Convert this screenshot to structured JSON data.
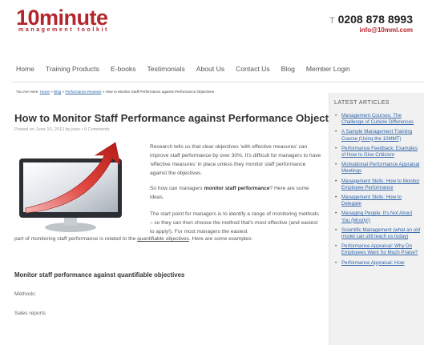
{
  "header": {
    "logo_main": "10minute",
    "logo_sub": "management toolkit",
    "phone_prefix": "T",
    "phone": "0208 878 8993",
    "email": "info@10mml.com"
  },
  "nav": [
    "Home",
    "Training Products",
    "E-books",
    "Testimonials",
    "About Us",
    "Contact Us",
    "Blog",
    "Member Login"
  ],
  "breadcrumb": {
    "prefix": "You Are Here:",
    "home": "Home",
    "sep1": "»",
    "blog": "Blog",
    "sep2": "»",
    "category": "Performance Reviews",
    "sep3": "»",
    "current": "How to Monitor Staff Performance against Performance Objectives"
  },
  "article": {
    "title": "How to Monitor Staff Performance against Performance Objectives",
    "meta": "Posted on June 10, 2012 by joan • 0 Comments",
    "p1": "Research tells us that clear objectives 'with effective measures' can improve staff performance by over 30%. It's difficult for managers to have 'effective measures' in place unless they monitor staff performance against the objectives.",
    "p2_pre": "So how can managers ",
    "p2_bold": "monitor staff performance",
    "p2_post": "? Here are some ideas.",
    "p3": "The start point for managers is to identify a range of monitoring methods – so they can then choose the method that's most effective (and easiest to apply!). For most managers the easiest",
    "p4_pre": "part of monitoring staff performance is related to the ",
    "p4_link": "quantifiable objectives",
    "p4_post": ". Here are some examples:",
    "subheading": "Monitor staff performance against quantifiable objectives",
    "label_methods": "Methods:",
    "label_sales": "Sales reports"
  },
  "sidebar": {
    "heading": "LATEST ARTICLES",
    "items": [
      "Management Courses: The Challenge of Cubicle Differences",
      "A Sample Management Training Course (Using the 10MMT)",
      "Performance Feedback: Examples of How to Give Criticism",
      "Motivational Performance Appraisal Meetings",
      "Management Skills: How to Monitor Employee Performance",
      "Management Skills: How to Delegate",
      "Managing People: It's Not About You (Mostly!)",
      "Scientific Management (what an old model can still teach us today)",
      "Performance Appraisal: Why Do Employees Want So Much Praise?",
      "Performance Appraisal: How"
    ]
  },
  "colors": {
    "brand": "#b3262b",
    "link": "#3366aa",
    "sidebar_bg": "#f1f1f1"
  },
  "icons": {
    "hero": "monitor-with-rising-arrow-image"
  }
}
